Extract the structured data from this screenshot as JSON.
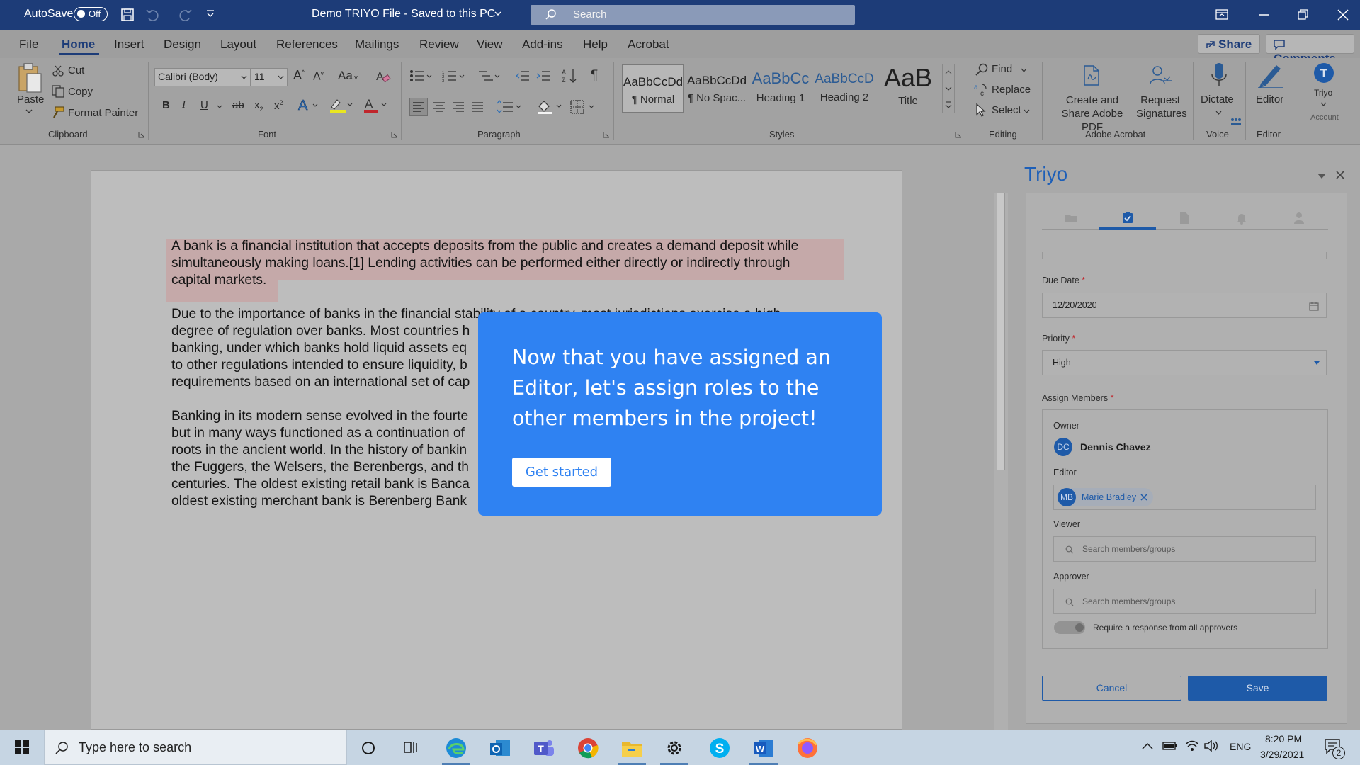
{
  "titlebar": {
    "autosave_label": "AutoSave",
    "autosave_state": "Off",
    "doc_title": "Demo TRIYO File - Saved to this PC",
    "search_placeholder": "Search"
  },
  "menu": {
    "items": [
      "File",
      "Home",
      "Insert",
      "Design",
      "Layout",
      "References",
      "Mailings",
      "Review",
      "View",
      "Add-ins",
      "Help",
      "Acrobat"
    ],
    "active": "Home",
    "share_label": "Share",
    "comments_label": "Comments"
  },
  "ribbon": {
    "clipboard": {
      "paste": "Paste",
      "cut": "Cut",
      "copy": "Copy",
      "format_painter": "Format Painter",
      "group": "Clipboard"
    },
    "font": {
      "font_name": "Calibri (Body)",
      "font_size": "11",
      "group": "Font"
    },
    "paragraph": {
      "group": "Paragraph"
    },
    "styles": {
      "items": [
        {
          "preview": "AaBbCcDd",
          "name": "¶ Normal"
        },
        {
          "preview": "AaBbCcDd",
          "name": "¶ No Spac..."
        },
        {
          "preview": "AaBbCc",
          "name": "Heading 1"
        },
        {
          "preview": "AaBbCcD",
          "name": "Heading 2"
        },
        {
          "preview": "AaB",
          "name": "Title"
        }
      ],
      "group": "Styles"
    },
    "editing": {
      "find": "Find",
      "replace": "Replace",
      "select": "Select",
      "group": "Editing"
    },
    "acrobat": {
      "create_share": "Create and Share Adobe PDF",
      "request_signatures": "Request Signatures",
      "group": "Adobe Acrobat"
    },
    "voice": {
      "dictate": "Dictate",
      "group": "Voice"
    },
    "editor": {
      "editor": "Editor",
      "group": "Editor"
    },
    "triyo": {
      "label": "Triyo",
      "sub": "Account"
    }
  },
  "document": {
    "paragraphs": [
      [
        "A bank is a financial institution that accepts deposits from the public and creates a demand deposit while",
        "simultaneously making loans.[1] Lending activities can be performed either directly or indirectly through",
        "capital markets."
      ],
      [
        "Due to the importance of banks in the financial stability of a country, most jurisdictions exercise a high",
        "degree of regulation over banks. Most countries h",
        "banking, under which banks hold liquid assets eq",
        "to other regulations intended to ensure liquidity, b",
        "requirements based on an international set of cap"
      ],
      [
        "Banking in its modern sense evolved in the fourte",
        "but in many ways functioned as a continuation of",
        "roots in the ancient world. In the history of bankin",
        "the Fuggers, the Welsers, the Berenbergs, and th",
        "centuries. The oldest existing retail bank is Banca",
        "oldest existing merchant bank is Berenberg Bank"
      ]
    ]
  },
  "popup": {
    "message": "Now that you have assigned an Editor, let's assign roles to the other members in the project!",
    "button": "Get started"
  },
  "pane": {
    "title": "Triyo",
    "due_date_label": "Due Date",
    "due_date": "12/20/2020",
    "priority_label": "Priority",
    "priority": "High",
    "assign_label": "Assign Members",
    "required_mark": "*",
    "owner_label": "Owner",
    "owner_initials": "DC",
    "owner_name": "Dennis Chavez",
    "editor_label": "Editor",
    "editor_initials": "MB",
    "editor_name": "Marie Bradley",
    "viewer_label": "Viewer",
    "viewer_placeholder": "Search members/groups",
    "approver_label": "Approver",
    "approver_placeholder": "Search members/groups",
    "require_all_label": "Require a response from all approvers",
    "cancel": "Cancel",
    "save": "Save"
  },
  "taskbar": {
    "search_placeholder": "Type here to search",
    "language": "ENG",
    "time": "8:20 PM",
    "date": "3/29/2021",
    "notification_count": "2"
  }
}
